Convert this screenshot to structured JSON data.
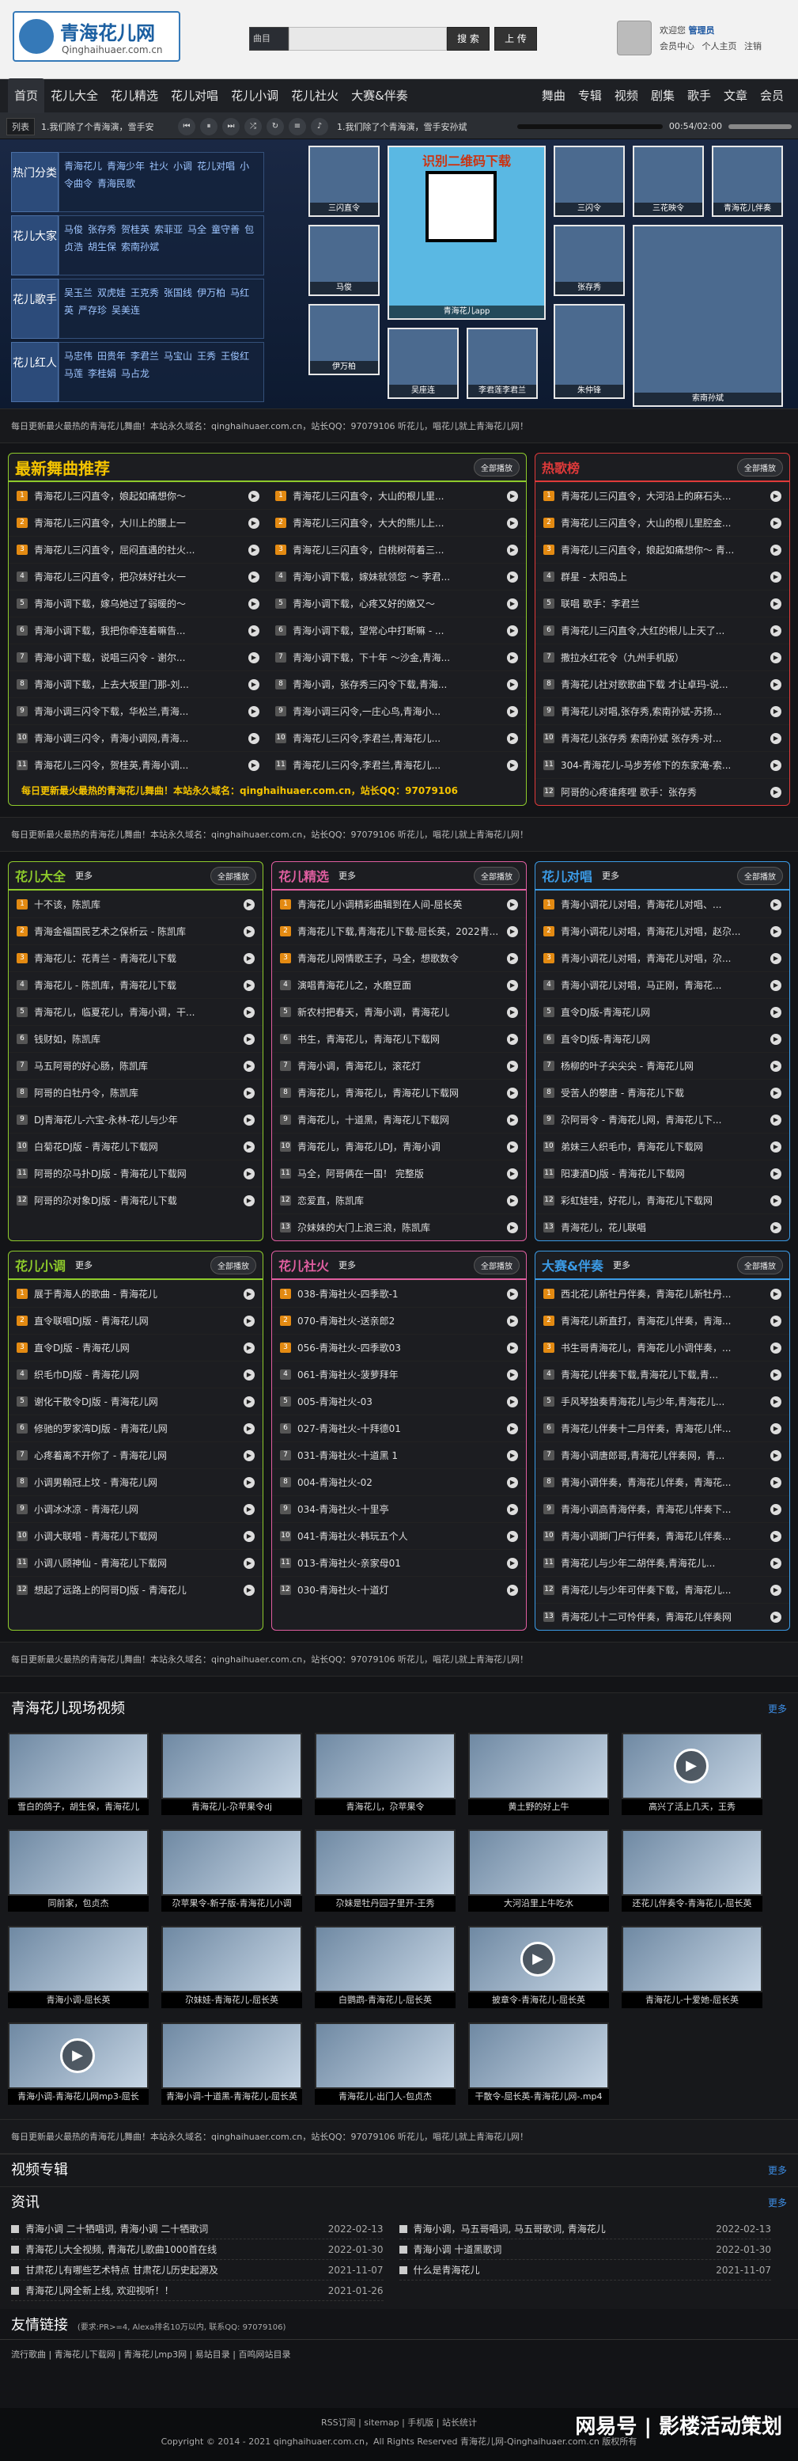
{
  "site": {
    "logo_cn": "青海花儿网",
    "logo_url": "Qinghaihuaer.com.cn"
  },
  "search": {
    "select": "曲目",
    "btn": "搜 索",
    "upload": "上 传"
  },
  "user": {
    "welcome": "欢迎您",
    "name": "管理员",
    "links": "会员中心 个人主页 注销"
  },
  "nav": {
    "items": [
      "首页",
      "花儿大全",
      "花儿精选",
      "花儿对唱",
      "花儿小调",
      "花儿社火",
      "大赛&伴奏",
      "舞曲",
      "专辑",
      "视频",
      "剧集",
      "歌手",
      "文章",
      "会员"
    ]
  },
  "player": {
    "list": "列表",
    "now": "1.我们除了个青海演，雪手安",
    "time": "00:54/02:00",
    "title": "1.我们除了个青海演，雪手安孙斌"
  },
  "cats": [
    {
      "h": "热门分类",
      "items": [
        "青海花儿",
        "青海少年",
        "社火",
        "小调",
        "花儿对唱",
        "小令曲令",
        "青海民歌"
      ]
    },
    {
      "h": "花儿大家",
      "items": [
        "马俊",
        "张存秀",
        "贺桂英",
        "索菲亚",
        "马全",
        "童守善",
        "包贞浩",
        "胡生保",
        "索南孙斌"
      ]
    },
    {
      "h": "花儿歌手",
      "items": [
        "吴玉兰",
        "双虎娃",
        "王克秀",
        "张国线",
        "伊万柏",
        "马红英",
        "严存珍",
        "吴美连"
      ]
    },
    {
      "h": "花儿红人",
      "items": [
        "马忠伟",
        "田贵年",
        "李君兰",
        "马宝山",
        "王秀",
        "王俊红",
        "马莲",
        "李桂娟",
        "马占龙"
      ]
    }
  ],
  "tiles": [
    {
      "cap": "三闪直令"
    },
    {
      "cap": "识别二维码下载",
      "qr": true,
      "sub": "青海花儿app"
    },
    {
      "cap": "三闪令"
    },
    {
      "cap": "三花映令"
    },
    {
      "cap": "青海花儿伴奏"
    },
    {
      "cap": "马俊"
    },
    {
      "cap": "张存秀"
    },
    {
      "cap": "伊万柏"
    },
    {
      "cap": "吴座连"
    },
    {
      "cap": "李君莲李君兰"
    },
    {
      "cap": "朱仲锋"
    },
    {
      "cap": "索南孙斌"
    }
  ],
  "notice": "每日更新最火最热的青海花儿舞曲！本站永久域名：qinghaihuaer.com.cn，站长QQ：97079106 听花儿，唱花儿就上青海花儿网！",
  "top3": [
    {
      "title": "最新舞曲推荐",
      "color": "#8ecb2b",
      "all": "全部播放",
      "items": [
        "青海花儿三闪直令，娘起如痛想你～",
        "青海花儿三闪直令，大川上的腰上一",
        "青海花儿三闪直令，屈闷直遇的社火...",
        "青海花儿三闪直令，把尕妹好社火一",
        "青海小调下载，嫁乌她过了弱暖的～",
        "青海小调下载，我把你牵连着嘛告...",
        "青海小调下载，说唱三闪令 - 谢尔...",
        "青海小调下载，上去大坂里门那-刘...",
        "青海小调三闪令下载，华松兰,青海...",
        "青海小调三闪令，青海小调网,青海...",
        "青海花儿三闪令，贺桂英,青海小调..."
      ]
    },
    {
      "title": "",
      "color": "#8ecb2b",
      "all": "",
      "items": [
        "青海花儿三闪直令，大山的根儿里...",
        "青海花儿三闪直令，大大的熊儿上...",
        "青海花儿三闪直令，白桃树荷着三...",
        "青海小调下载，嫁妹就领您 ～ 李君...",
        "青海小调下载，心疼又好的嫩又～",
        "青海小调下载，望常心中打断嘛 - ...",
        "青海小调下载，下十年 ～沙金,青海...",
        "青海小调，张存秀三闪令下载,青海...",
        "青海小调三闪令,一庄心鸟,青海小...",
        "青海花儿三闪令,李君兰,青海花儿...",
        "青海花儿三闪令,李君兰,青海花儿..."
      ]
    },
    {
      "title": "热歌榜",
      "color": "#e03a3a",
      "all": "全部播放",
      "items": [
        "青海花儿三闪直令，大河沿上的麻石头...",
        "青海花儿三闪直令，大山的根儿里腔金...",
        "青海花儿三闪直令，娘起如痛想你～ 青...",
        "群星 - 太阳岛上",
        "联唱 歌手：李君兰",
        "青海花儿三闪直令,大红的根儿上天了...",
        "撒拉水红花令（九州手机版）",
        "青海花儿社对歌歌曲下载 才让卓玛-说...",
        "青海花儿对唱,张存秀,索南孙斌-苏扬...",
        "青海花儿张存秀 索南孙斌 张存秀-对...",
        "304-青海花儿-马步芳修下的东家淹-索...",
        "阿哥的心疼谁疼哩 歌手：张存秀"
      ]
    }
  ],
  "foot_notice": "每日更新最火最热的青海花儿舞曲！本站永久域名：qinghaihuaer.com.cn，站长QQ：97079106",
  "row2": [
    {
      "title": "花儿大全",
      "color": "#8ecb2b",
      "items": [
        "十不该，陈凯库",
        "青海金福国民艺术之保析云 - 陈凯库",
        "青海花儿：花青兰 - 青海花儿下载",
        "青海花儿 - 陈凯库，青海花儿下载",
        "青海花儿，临夏花儿，青海小调，干...",
        "钱财如，陈凯库",
        "马五阿哥的好心肠，陈凯库",
        "阿哥的白牡丹令，陈凯库",
        "DJ青海花儿-六宝-永林-花儿与少年",
        "白菊花DJ版 - 青海花儿下载网",
        "阿哥的尕马扑DJ版 - 青海花儿下载网",
        "阿哥的尕对象DJ版 - 青海花儿下载"
      ]
    },
    {
      "title": "花儿精选",
      "color": "#e05ea0",
      "items": [
        "青海花儿小调精彩曲辑到在人间-屈长英",
        "青海花儿下载,青海花儿下载-屈长英，2022青...",
        "青海花儿网情歌王子，马全，想歌数令",
        "演唱青海花儿之，水磨豆面",
        "新农村把春天，青海小调，青海花儿",
        "书生，青海花儿，青海花儿下载网",
        "青海小调，青海花儿，滚花灯",
        "青海花儿，青海花儿，青海花儿下载网",
        "青海花儿，十道黑，青海花儿下载网",
        "青海花儿，青海花儿DJ，青海小调",
        "马全，阿哥俩在一国！ 完整版",
        "恋爱直，陈凯库",
        "尕妹妹的大门上浪三浪，陈凯库"
      ]
    },
    {
      "title": "花儿对唱",
      "color": "#3b9be6",
      "items": [
        "青海小调花儿对唱，青海花儿对唱、...",
        "青海小调花儿对唱，青海花儿对唱，赵尕...",
        "青海小调花儿对唱，青海花儿对唱，尕...",
        "青海小调花儿对唱，马正刚，青海花...",
        "直令DJ版-青海花儿网",
        "直令DJ版-青海花儿网",
        "杨柳的叶子尖尖尖 - 青海花儿网",
        "受苦人的攀唐 - 青海花儿下载",
        "尕阿哥令 - 青海花儿网，青海花儿下...",
        "弟妹三人织毛巾，青海花儿下载网",
        "阳凄酒DJ版 - 青海花儿下载网",
        "彩虹娃哇，好花儿，青海花儿下载网",
        "青海花儿，花儿联唱"
      ]
    }
  ],
  "row3": [
    {
      "title": "花儿小调",
      "color": "#8ecb2b",
      "items": [
        "展于青海人的歌曲 - 青海花儿",
        "直令联唱DJ版 - 青海花儿网",
        "直令DJ版 - 青海花儿网",
        "织毛巾DJ版 - 青海花儿网",
        "谢化干散令DJ版 - 青海花儿网",
        "修驰的罗家湾DJ版 - 青海花儿网",
        "心疼着离不开你了 - 青海花儿网",
        "小调男翰冠上坟 - 青海花儿网",
        "小调冰冰凉 - 青海花儿网",
        "小调大联唱 - 青海花儿下载网",
        "小调八顾神仙 - 青海花儿下载网",
        "想起了远路上的阿哥DJ版 - 青海花儿"
      ]
    },
    {
      "title": "花儿社火",
      "color": "#e05ea0",
      "items": [
        "038-青海社火-四季歌-1",
        "070-青海社火-送亲郎2",
        "056-青海社火-四季歌03",
        "061-青海社火-菠萝拜年",
        "005-青海社火-03",
        "027-青海社火-十拜德01",
        "031-青海社火-十道黑 1",
        "004-青海社火-02",
        "034-青海社火-十里亭",
        "041-青海社火-韩玩五个人",
        "013-青海社火-亲家母01",
        "030-青海社火-十道灯"
      ]
    },
    {
      "title": "大赛&伴奏",
      "color": "#3b9be6",
      "items": [
        "西北花儿新牡丹伴奏，青海花儿新牡丹...",
        "青海花儿新直打，青海花儿伴奏，青海...",
        "书生哥青海花儿，青海花儿小调伴奏，...",
        "青海花儿伴奏下载,青海花儿下载,青...",
        "手风琴独奏青海花儿与少年,青海花儿...",
        "青海花儿伴奏十二月伴奏，青海花儿伴...",
        "青海小调唐郎哥,青海花儿伴奏网，青...",
        "青海小调伴奏，青海花儿伴奏，青海花...",
        "青海小调高青海伴奏，青海花儿伴奏下...",
        "青海小调脚门户行伴奏，青海花儿伴奏...",
        "青海花儿与少年二胡伴奏,青海花儿...",
        "青海花儿与少年可伴奏下载，青海花儿...",
        "青海花儿十二可怜伴奏，青海花儿伴奏网"
      ]
    }
  ],
  "videos": {
    "title": "青海花儿现场视频",
    "more": "更多",
    "items": [
      "雪白的鸽子，胡生保，青海花儿",
      "青海花儿-尕苹果令dj",
      "青海花儿，尕苹果令",
      "黄土野的好上牛",
      "高兴了活上几天，王秀",
      "同前家，包贞杰",
      "尕苹果令-新子版-青海花儿小调",
      "尕妹是牡丹园子里开-王秀",
      "大河沿里上牛吃水",
      "还花儿伴奏令-青海花儿-屈长英",
      "青海小调-屈长英",
      "尕妹娃-青海花儿-屈长英",
      "白鹦鹉-青海花儿-屈长英",
      "披章令-青海花儿-屈长英",
      "青海花儿-十爱她-屈长英",
      "青海小调-青海花儿网mp3-屈长",
      "青海小调-十道黑-青海花儿-屈长英",
      "青海花儿-出门人-包贞杰",
      "干散令-屈长英-青海花儿网-.mp4"
    ]
  },
  "album": {
    "title": "视频专辑",
    "more": "更多"
  },
  "news": {
    "title": "资讯",
    "more": "更多",
    "left": [
      [
        "青海小调 二十牺唱词, 青海小调 二十牺歌词",
        "2022-02-13"
      ],
      [
        "青海花儿大全视频, 青海花儿歌曲1000首在线",
        "2022-01-30"
      ],
      [
        "甘肃花儿有哪些艺术特点 甘肃花儿历史起源及",
        "2021-11-07"
      ],
      [
        "青海花儿网全新上线, 欢迎视听！！",
        "2021-01-26"
      ]
    ],
    "right": [
      [
        "青海小调，马五哥唱词, 马五哥歌词, 青海花儿",
        "2022-02-13"
      ],
      [
        "青海小调 十道黑歌词",
        "2022-01-30"
      ],
      [
        "什么是青海花儿",
        "2021-11-07"
      ]
    ]
  },
  "friend": {
    "title": "友情链接",
    "sub": "(要求:PR>=4, Alexa排名10万以内, 联系QQ: 97079106)",
    "links": "流行歌曲 | 青海花儿下载网 | 青海花儿mp3网 | 易站目录 | 百鸣网站目录"
  },
  "footer": {
    "links": "RSS订阅 | sitemap | 手机版 | 站长统计",
    "copy": "Copyright © 2014 - 2021 qinghaihuaer.com.cn，All Rights Reserved 青海花儿网-Qinghaihuaer.com.cn 版权所有"
  },
  "watermark": "网易号 | 影楼活动策划"
}
